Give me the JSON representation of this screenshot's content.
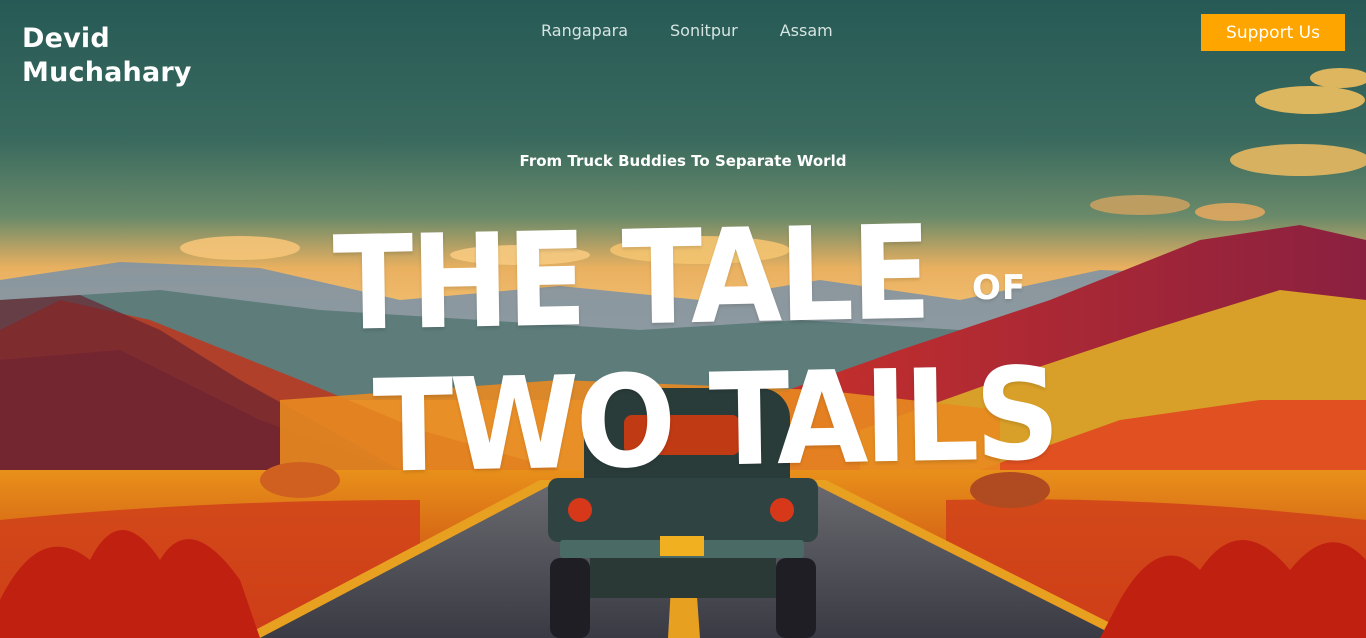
{
  "header": {
    "brand_name": "Devid Muchahary",
    "nav": [
      {
        "label": "Rangapara"
      },
      {
        "label": "Sonitpur"
      },
      {
        "label": "Assam"
      }
    ],
    "cta_label": "Support Us"
  },
  "hero": {
    "tagline": "From Truck Buddies To Separate World",
    "title_line1": "THE TALE",
    "title_of": "OF",
    "title_line2": "TWO TAILS"
  },
  "colors": {
    "cta_bg": "#ffa500",
    "sky": "#2a5a55"
  }
}
